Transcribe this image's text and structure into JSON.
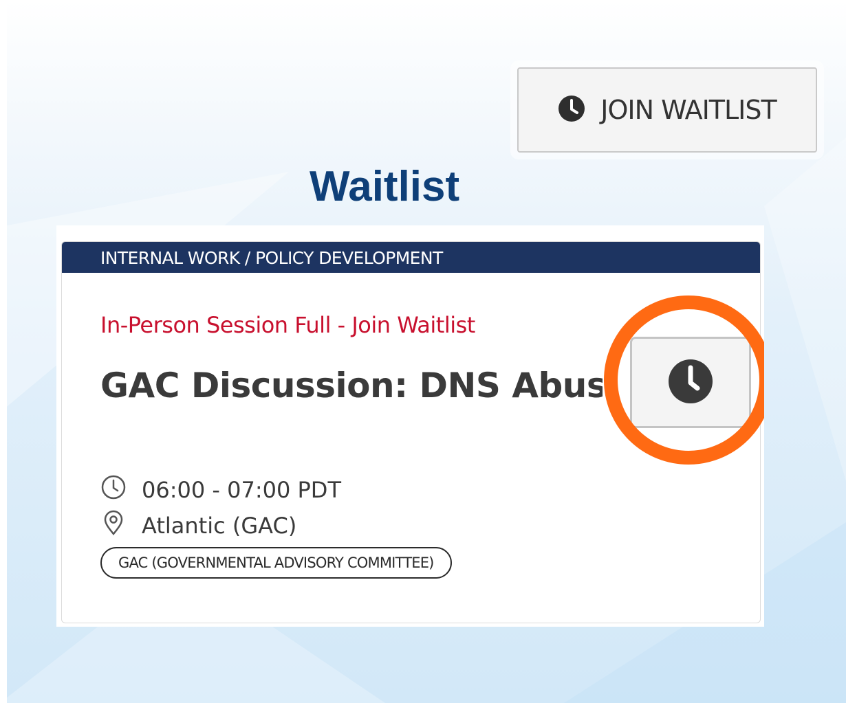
{
  "join_button": {
    "label": "JOIN WAITLIST",
    "icon": "clock-icon"
  },
  "heading": "Waitlist",
  "card": {
    "category": "INTERNAL WORK / POLICY DEVELOPMENT",
    "status": "In-Person Session Full - Join Waitlist",
    "title": "GAC Discussion: DNS Abus",
    "time": "06:00 - 07:00 PDT",
    "time_icon": "clock-outline-icon",
    "location": "Atlantic (GAC)",
    "location_icon": "map-pin-icon",
    "tag": "GAC (GOVERNMENTAL ADVISORY COMMITTEE)",
    "waitlist_icon": "clock-icon"
  },
  "colors": {
    "header_bg": "#1d3461",
    "status_text": "#c8102e",
    "heading_text": "#0e3f78",
    "highlight_ring": "#ff6a13"
  }
}
